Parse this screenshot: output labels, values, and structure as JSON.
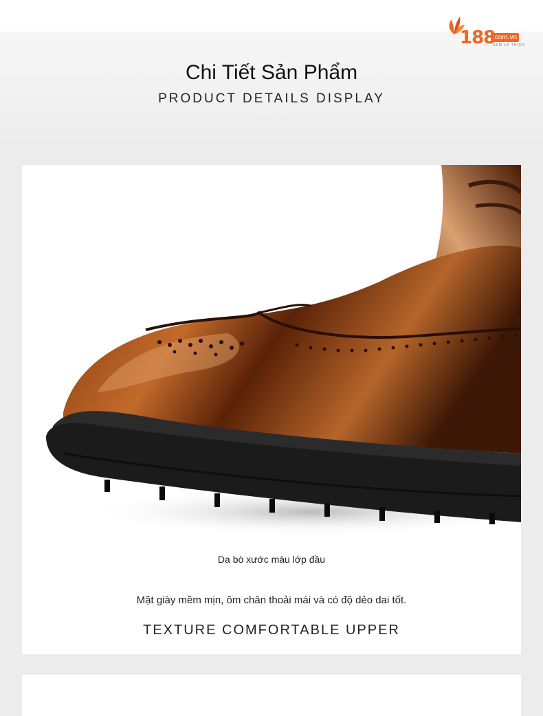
{
  "logo": {
    "number": "188",
    "domain": ".com.vn",
    "tagline": "XEM LÀ THÍCH",
    "color": "#f26522"
  },
  "header": {
    "title": "Chi Tiết Sản Phẩm",
    "subtitle": "PRODUCT DETAILS DISPLAY"
  },
  "product": {
    "image_subject": "brown-brogue-leather-shoe",
    "caption": "Da bò xước màu lớp đầu",
    "description": "Mặt giày mềm mịn, ôm chân thoải mái và có độ dẻo dai tốt.",
    "feature_heading": "TEXTURE COMFORTABLE UPPER"
  },
  "colors": {
    "leather": "#8a3d14",
    "sole": "#1b1b1b",
    "page_bg": "#ececec"
  }
}
